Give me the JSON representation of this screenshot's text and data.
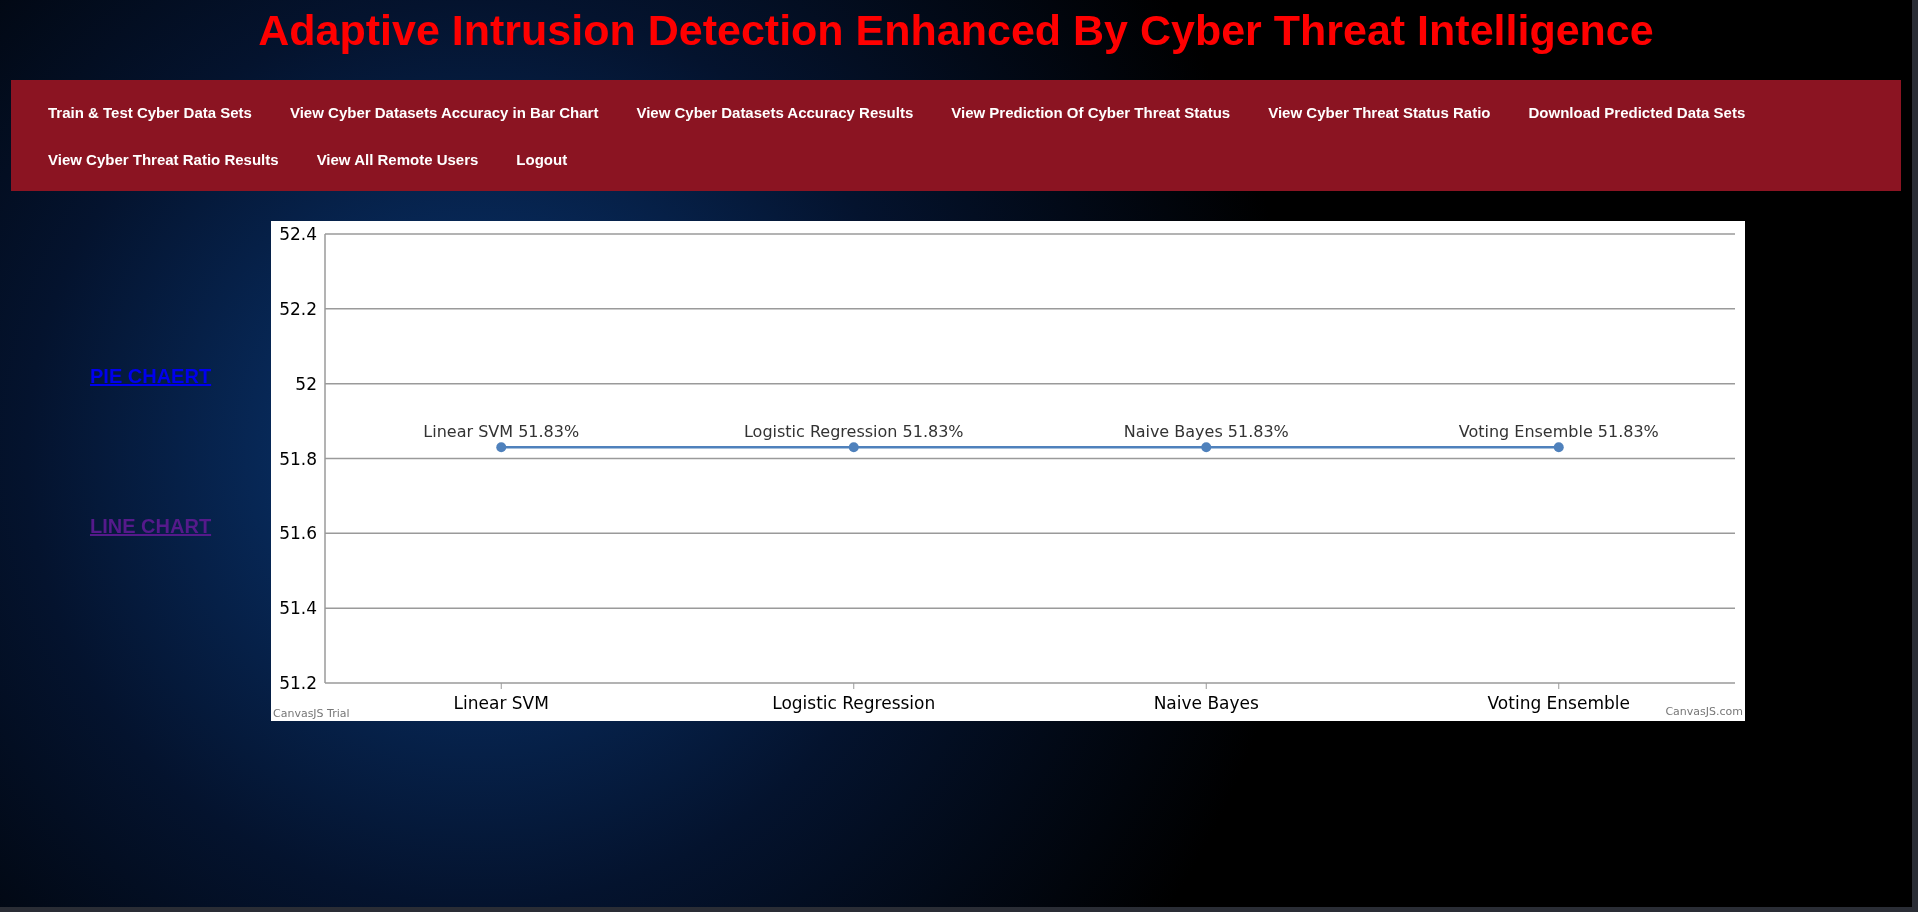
{
  "header": {
    "title": "Adaptive Intrusion Detection Enhanced By Cyber Threat Intelligence"
  },
  "nav": {
    "items": [
      {
        "label": "Train & Test Cyber Data Sets"
      },
      {
        "label": "View Cyber Datasets Accuracy in Bar Chart"
      },
      {
        "label": "View Cyber Datasets Accuracy Results"
      },
      {
        "label": "View Prediction Of Cyber Threat Status"
      },
      {
        "label": "View Cyber Threat Status Ratio"
      },
      {
        "label": "Download Predicted Data Sets"
      },
      {
        "label": "View Cyber Threat Ratio Results"
      },
      {
        "label": "View All Remote Users"
      },
      {
        "label": "Logout"
      }
    ]
  },
  "chart_links": [
    {
      "label": "PIE CHAERT",
      "visited": false
    },
    {
      "label": "LINE CHART",
      "visited": true
    }
  ],
  "chart": {
    "trial_label": "CanvasJS Trial",
    "credit": "CanvasJS.com",
    "chart_data": {
      "type": "line",
      "categories": [
        "Linear SVM",
        "Logistic Regression",
        "Naive Bayes",
        "Voting Ensemble"
      ],
      "series": [
        {
          "color": "#4f81bc",
          "marker": "circle",
          "values": [
            51.83,
            51.83,
            51.83,
            51.83
          ]
        }
      ],
      "grid": true,
      "ylim": [
        51.2,
        52.4
      ],
      "yticks": [
        {
          "value": 51.2,
          "label": "51.2"
        },
        {
          "value": 51.4,
          "label": "51.4"
        },
        {
          "value": 51.6,
          "label": "51.6"
        },
        {
          "value": 51.8,
          "label": "51.8"
        },
        {
          "value": 52,
          "label": "52"
        },
        {
          "value": 52.2,
          "label": "52.2"
        },
        {
          "value": 52.4,
          "label": "52.4"
        }
      ],
      "value_labels": [
        "Linear SVM 51.83%",
        "Logistic Regression 51.83%",
        "Naive Bayes 51.83%",
        "Voting Ensemble 51.83%"
      ]
    }
  }
}
